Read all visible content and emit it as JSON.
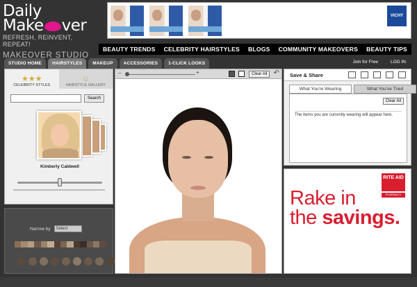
{
  "logo": {
    "line1": "Daily",
    "line2_a": "Make",
    "line2_b": "ver",
    "tagline": "REFRESH, REINVENT, REPEAT!",
    "studio": "MAKEOVER STUDIO"
  },
  "banner": {
    "brand": "VICHY"
  },
  "nav": [
    "BEAUTY TRENDS",
    "CELEBRITY HAIRSTYLES",
    "BLOGS",
    "COMMUNITY MAKEOVERS",
    "BEAUTY TIPS"
  ],
  "tabs": [
    "STUDIO HOME",
    "HAIRSTYLES",
    "MAKEUP",
    "ACCESSORIES",
    "1-CLICK LOOKS"
  ],
  "toplinks": {
    "join": "Join for Free",
    "login": "LOG IN"
  },
  "left": {
    "tab1": "CELEBRITY STYLES",
    "tab2": "HAIRSTYLE GALLERY",
    "search_button": "Search",
    "search_value": "",
    "celebrity": "Kimberly Caldwell",
    "narrow_label": "Narrow by",
    "narrow_select": "Select"
  },
  "colors": {
    "swatches": [
      "#8b6e58",
      "#a38a71",
      "#b49d82",
      "#6d5a4a",
      "#9a856c",
      "#c2ad92",
      "#574436",
      "#7b6651",
      "#b8a48c",
      "#4a3a30",
      "#3a2f28",
      "#6b5848",
      "#8a7763",
      "#5f4c3d"
    ],
    "circles": [
      "#5a4a3e",
      "#6e5d4f",
      "#807060",
      "#5d4e41",
      "#716151",
      "#8a7a69",
      "#6a5848",
      "#7c6b5b",
      "#564639"
    ]
  },
  "work": {
    "clear": "Clear All",
    "minus": "−",
    "plus": "+"
  },
  "right": {
    "title": "Save & Share",
    "tab_wearing": "What You're Wearing",
    "tab_tried": "What You've Tried",
    "clear": "Clear All",
    "message": "The items you are currently wearing will appear here."
  },
  "ad": {
    "line1": "Rake in",
    "line2_a": "the ",
    "line2_b": "savings.",
    "logo_top": "RITE AID",
    "logo_bottom": "PHARMACY"
  }
}
